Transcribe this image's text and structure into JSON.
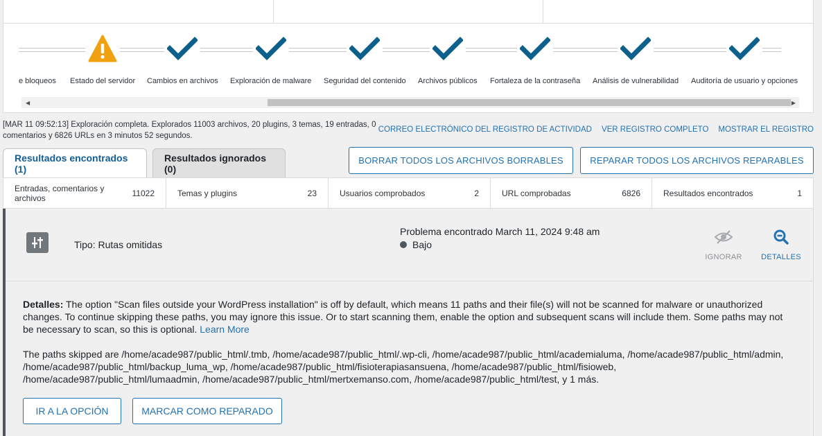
{
  "stages": [
    {
      "label": "e bloqueos",
      "status": "none"
    },
    {
      "label": "Estado del servidor",
      "status": "warning"
    },
    {
      "label": "Cambios en archivos",
      "status": "complete"
    },
    {
      "label": "Exploración de malware",
      "status": "complete"
    },
    {
      "label": "Seguridad del contenido",
      "status": "complete"
    },
    {
      "label": "Archivos públicos",
      "status": "complete"
    },
    {
      "label": "Fortaleza de la contraseña",
      "status": "complete"
    },
    {
      "label": "Análisis de vulnerabilidad",
      "status": "complete"
    },
    {
      "label": "Auditoría de usuario y opciones",
      "status": "complete"
    }
  ],
  "scroll": {
    "left_arrow": "◀",
    "right_arrow": "▶"
  },
  "log": {
    "message": "[MAR 11 09:52:13] Exploración completa. Explorados 11003 archivos, 20 plugins, 3 temas, 19 entradas, 0 comentarios y 6826 URLs en 3 minutos 52 segundos.",
    "links": [
      "CORREO ELECTRÓNICO DEL REGISTRO DE ACTIVIDAD",
      "VER REGISTRO COMPLETO",
      "MOSTRAR EL REGISTRO"
    ]
  },
  "tabs": {
    "found": "Resultados encontrados (1)",
    "ignored": "Resultados ignorados (0)"
  },
  "actions": {
    "delete_all": "BORRAR TODOS LOS ARCHIVOS BORRABLES",
    "repair_all": "REPARAR TODOS LOS ARCHIVOS REPARABLES"
  },
  "summary": [
    {
      "label": "Entradas, comentarios y archivos",
      "value": "11022"
    },
    {
      "label": "Temas y plugins",
      "value": "23"
    },
    {
      "label": "Usuarios comprobados",
      "value": "2"
    },
    {
      "label": "URL comprobadas",
      "value": "6826"
    },
    {
      "label": "Resultados encontrados",
      "value": "1"
    }
  ],
  "issue": {
    "type": "Tipo: Rutas omitidas",
    "problem": "Problema encontrado March 11, 2024 9:48 am",
    "severity": "Bajo",
    "ignore_label": "IGNORAR",
    "details_label": "DETALLES",
    "details_heading": "Detalles:",
    "details_text": " The option \"Scan files outside your WordPress installation\" is off by default, which means 11 paths and their file(s) will not be scanned for malware or unauthorized changes. To continue skipping these paths, you may ignore this issue. Or to start scanning them, enable the option and subsequent scans will include them. Some paths may not be necessary to scan, so this is optional. ",
    "learn_more": "Learn More",
    "paths_text": "The paths skipped are /home/acade987/public_html/.tmb, /home/acade987/public_html/.wp-cli, /home/acade987/public_html/academialuma, /home/acade987/public_html/admin, /home/acade987/public_html/backup_luma_wp, /home/acade987/public_html/fisioterapiasansuena, /home/acade987/public_html/fisioweb, /home/acade987/public_html/lumaadmin, /home/acade987/public_html/mertxemanso.com, /home/acade987/public_html/test, y 1 más.",
    "go_option": "IR A LA OPCIÓN",
    "mark_fixed": "MARCAR COMO REPARADO"
  }
}
